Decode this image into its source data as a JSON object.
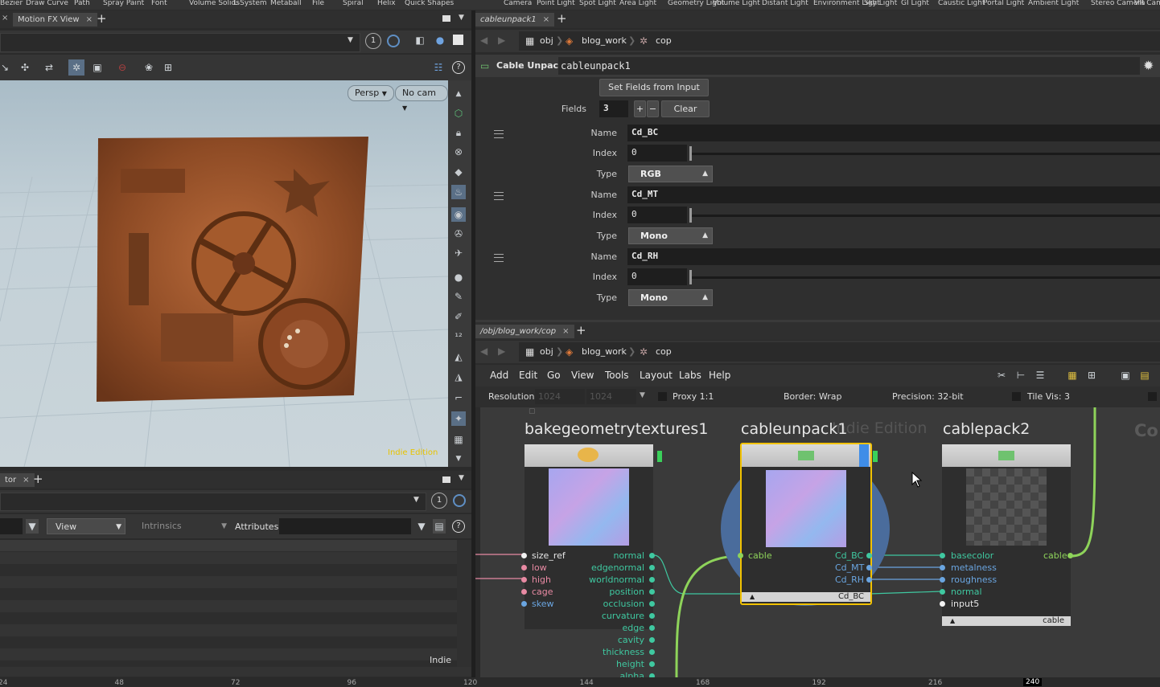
{
  "shelf_tools": [
    "Bezier",
    "Draw Curve",
    "Path",
    "Spray Paint",
    "Font",
    "Volume Solids",
    "L-System",
    "Metaball",
    "File",
    "Spiral",
    "Helix",
    "Quick Shapes",
    "Camera",
    "Point Light",
    "Spot Light",
    "Area Light",
    "Geometry Light",
    "Volume Light",
    "Distant Light",
    "Environment Light",
    "Sky Light",
    "GI Light",
    "Caustic Light",
    "Portal Light",
    "Ambient Light",
    "Stereo Camera",
    "VR Came"
  ],
  "left_top_tab": {
    "label": "Motion FX View",
    "close": "×"
  },
  "viewport": {
    "display_num": "1",
    "persp_label": "Persp",
    "cam_label": "No cam",
    "watermark": "Indie Edition"
  },
  "spreadsheet": {
    "tab_label": "tor",
    "tab_close": "×",
    "display_num": "1",
    "view_label": "View",
    "intrinsics_label": "Intrinsics",
    "attributes_label": "Attributes:",
    "corner_text": "Indie"
  },
  "params": {
    "tab_label": "cableunpack1",
    "tab_close": "×",
    "crumbs": [
      "obj",
      "blog_work",
      "cop"
    ],
    "node_type": "Cable Unpack",
    "node_name": "cableunpack1",
    "set_fields_label": "Set Fields from Input",
    "fields_label": "Fields",
    "fields_value": "3",
    "plus": "+",
    "minus": "−",
    "clear_label": "Clear",
    "name_label": "Name",
    "index_label": "Index",
    "type_label": "Type",
    "fields": [
      {
        "name": "Cd_BC",
        "index": "0",
        "type": "RGB"
      },
      {
        "name": "Cd_MT",
        "index": "0",
        "type": "Mono"
      },
      {
        "name": "Cd_RH",
        "index": "0",
        "type": "Mono"
      }
    ]
  },
  "network": {
    "tab_label": "/obj/blog_work/cop",
    "tab_close": "×",
    "crumbs": [
      "obj",
      "blog_work",
      "cop"
    ],
    "menu": [
      "Add",
      "Edit",
      "Go",
      "View",
      "Tools",
      "Layout",
      "Labs",
      "Help"
    ],
    "resolution_label": "Resolution",
    "res_w": "1024",
    "res_h": "1024",
    "proxy_label": "Proxy 1:1",
    "border_label": "Border: Wrap",
    "precision_label": "Precision: 32-bit",
    "tilevis_label": "Tile Vis: 3",
    "watermark": "Indie Edition",
    "node1": {
      "title": "bakegeometrytextures1",
      "inputs": [
        "size_ref",
        "low",
        "high",
        "cage",
        "skew"
      ],
      "outputs": [
        "normal",
        "edgenormal",
        "worldnormal",
        "position",
        "occlusion",
        "curvature",
        "edge",
        "cavity",
        "thickness",
        "height",
        "alpha"
      ]
    },
    "node2": {
      "title": "cableunpack1",
      "input": "cable",
      "outputs": [
        "Cd_BC",
        "Cd_MT",
        "Cd_RH"
      ],
      "footer": "Cd_BC"
    },
    "node3": {
      "title": "cablepack2",
      "inputs": [
        "basecolor",
        "metalness",
        "roughness",
        "normal",
        "input5"
      ],
      "output": "cable",
      "footer": "cable"
    },
    "cut_title": "Co"
  },
  "ruler": [
    "24",
    "48",
    "72",
    "96",
    "120",
    "144",
    "168",
    "192",
    "216",
    "240"
  ],
  "colors": {
    "selected_node": "#f2c200",
    "wire_green": "#8ed35a",
    "pink_port": "#e88aa3",
    "teal_port": "#3fc8a0",
    "blue_port": "#6aa5e0"
  }
}
